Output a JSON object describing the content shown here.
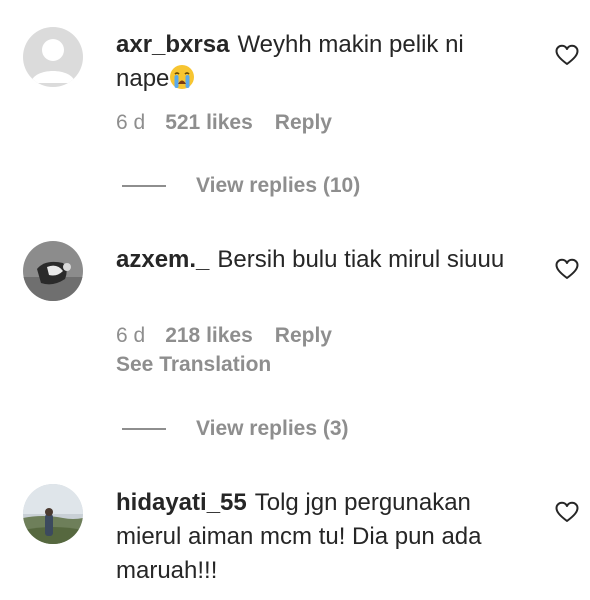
{
  "comments": [
    {
      "username": "axr_bxrsa",
      "text": "Weyhh makin pelik ni nape",
      "emoji": "loudly-crying-face",
      "time": "6 d",
      "likes": "521 likes",
      "reply_label": "Reply",
      "view_replies": "View replies (10)"
    },
    {
      "username": "azxem._",
      "text": "Bersih bulu tiak mirul siuuu",
      "time": "6 d",
      "likes": "218 likes",
      "reply_label": "Reply",
      "see_translation": "See Translation",
      "view_replies": "View replies (3)"
    },
    {
      "username": "hidayati_55",
      "text": "Tolg jgn pergunakan mierul aiman mcm tu! Dia pun ada maruah!!!"
    }
  ],
  "icons": {
    "heart": "heart-outline-icon",
    "default_avatar": "default-avatar-icon"
  },
  "colors": {
    "text": "#262626",
    "secondary": "#8e8e8e",
    "background": "#ffffff"
  }
}
